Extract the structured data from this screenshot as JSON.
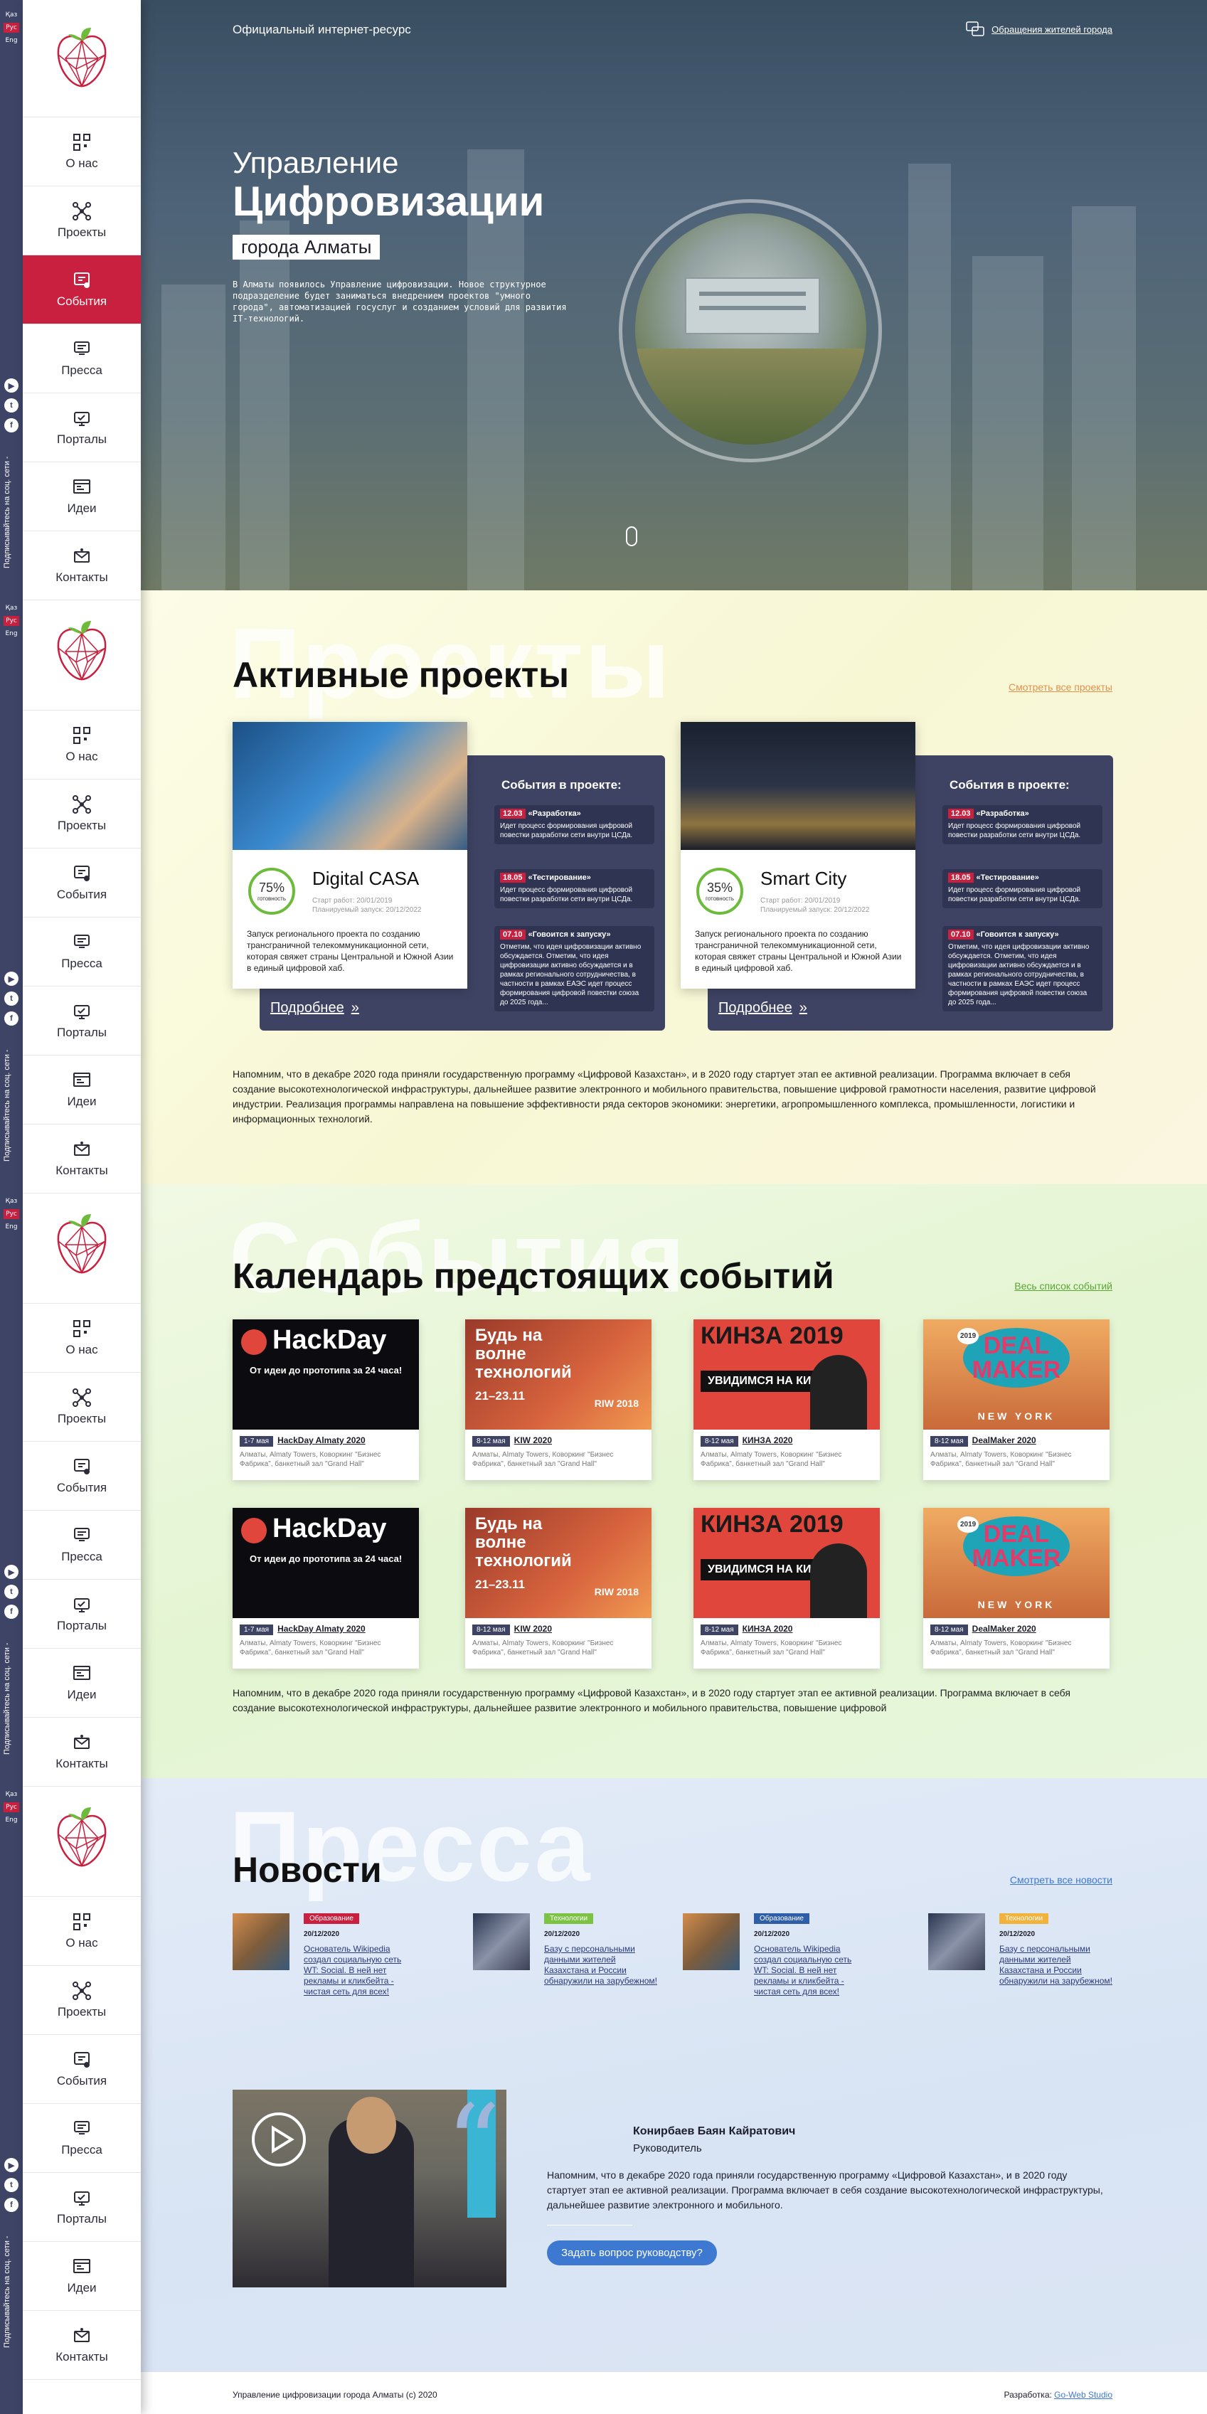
{
  "langs": [
    "Қаз",
    "Рус",
    "Eng"
  ],
  "social_text": "Подписывайтесь на соц. сети -",
  "social_icons": [
    "youtube-icon",
    "twitter-icon",
    "facebook-icon"
  ],
  "nav": [
    {
      "label": "О нас",
      "icon": "qr-icon"
    },
    {
      "label": "Проекты",
      "icon": "network-icon"
    },
    {
      "label": "События",
      "icon": "events-icon"
    },
    {
      "label": "Пресса",
      "icon": "press-icon"
    },
    {
      "label": "Порталы",
      "icon": "portal-icon"
    },
    {
      "label": "Идеи",
      "icon": "ideas-icon"
    },
    {
      "label": "Контакты",
      "icon": "contacts-icon"
    }
  ],
  "hero": {
    "top_label": "Официальный интернет-ресурс",
    "appeal_link": "Обращения жителей города",
    "line1": "Управление",
    "line2": "Цифровизации",
    "line3": "города Алматы",
    "desc": "В Алматы появилось Управление цифровизации. Новое структурное подразделение будет заниматься внедрением проектов \"умного города\", автоматизацией госуслуг и созданием условий для развития IT-технологий."
  },
  "projects": {
    "bg_word": "Проекты",
    "title": "Активные проекты",
    "all_link": "Смотреть все проекты",
    "events_title": "События в проекте:",
    "more_label": "Подробнее",
    "items": [
      {
        "name": "Digital CASA",
        "progress": "75%",
        "progress_label": "готовность",
        "start": "Старт работ: 20/01/2019",
        "planned": "Планируемый запуск: 20/12/2022",
        "text": "Запуск регионального проекта по созданию трансграничной телекоммуникационной сети, которая свяжет страны Центральной и Южной Азии в единый цифровой хаб.",
        "events": [
          {
            "date": "12.03",
            "title": "«Разработка»",
            "text": "Идет процесс формирования цифровой повестки разработки сети внутри ЦСДа."
          },
          {
            "date": "18.05",
            "title": "«Тестирование»",
            "text": "Идет процесс формирования цифровой повестки разработки сети внутри ЦСДа."
          },
          {
            "date": "07.10",
            "title": "«Говоится к запуску»",
            "text": "Отметим, что идея цифровизации активно обсуждается. Отметим, что идея цифровизации активно обсуждается и в рамках регионального сотрудничества, в частности в рамках ЕАЭС идет процесс формирования цифровой повестки союза до 2025 года..."
          }
        ]
      },
      {
        "name": "Smart City",
        "progress": "35%",
        "progress_label": "готовность",
        "start": "Старт работ: 20/01/2019",
        "planned": "Планируемый запуск: 20/12/2022",
        "text": "Запуск регионального проекта по созданию трансграничной телекоммуникационной сети, которая свяжет страны Центральной и Южной Азии в единый цифровой хаб.",
        "events": [
          {
            "date": "12.03",
            "title": "«Разработка»",
            "text": "Идет процесс формирования цифровой повестки разработки сети внутри ЦСДа."
          },
          {
            "date": "18.05",
            "title": "«Тестирование»",
            "text": "Идет процесс формирования цифровой повестки разработки сети внутри ЦСДа."
          },
          {
            "date": "07.10",
            "title": "«Говоится к запуску»",
            "text": "Отметим, что идея цифровизации активно обсуждается. Отметим, что идея цифровизации активно обсуждается и в рамках регионального сотрудничества, в частности в рамках ЕАЭС идет процесс формирования цифровой повестки союза до 2025 года..."
          }
        ]
      }
    ],
    "para": "Напомним, что в декабре 2020 года приняли государственную программу «Цифровой Казахстан», и в 2020 году стартует этап ее активной реализации. Программа включает в себя создание высокотехнологической инфраструктуры, дальнейшее развитие электронного и мобильного правительства, повышение цифровой грамотности населения, развитие цифровой индустрии. Реализация программы направлена на повышение эффективности ряда секторов экономики: энергетики, агропромышленного комплекса, промышленности, логистики и информационных технологий."
  },
  "events": {
    "bg_word": "События",
    "title": "Календарь предстоящих событий",
    "all_link": "Весь список событий",
    "items": [
      {
        "tag": "1-7 мая",
        "name": "HackDay Almaty 2020",
        "addr": "Алматы, Almaty Towers, Коворкинг \"Бизнес Фабрика\", банкетный зал \"Grand Hall\"",
        "img": "hackday",
        "img_title": "HackDay",
        "img_sub": "От идеи до прототипа за 24 часа!"
      },
      {
        "tag": "8-12 мая",
        "name": "KIW 2020",
        "addr": "Алматы, Almaty Towers, Коворкинг \"Бизнес Фабрика\", банкетный зал \"Grand Hall\"",
        "img": "kiw",
        "img_title": "Будь на волне технологий",
        "img_sub": "21–23.11",
        "img_extra": "RIW 2018"
      },
      {
        "tag": "8-12 мая",
        "name": "КИНЗА 2020",
        "addr": "Алматы, Almaty Towers, Коворкинг \"Бизнес Фабрика\", банкетный зал \"Grand Hall\"",
        "img": "kinza",
        "img_title": "КИНЗА 2019",
        "img_sub": "УВИДИМСЯ НА КИНЗЕ"
      },
      {
        "tag": "8-12 мая",
        "name": "DealMaker 2020",
        "addr": "Алматы, Almaty Towers, Коворкинг \"Бизнес Фабрика\", банкетный зал \"Grand Hall\"",
        "img": "deal",
        "img_title": "DEAL MAKER",
        "img_sub": "NEW YORK",
        "img_extra": "2019"
      },
      {
        "tag": "1-7 мая",
        "name": "HackDay Almaty 2020",
        "addr": "Алматы, Almaty Towers, Коворкинг \"Бизнес Фабрика\", банкетный зал \"Grand Hall\"",
        "img": "hackday",
        "img_title": "HackDay",
        "img_sub": "От идеи до прототипа за 24 часа!"
      },
      {
        "tag": "8-12 мая",
        "name": "KIW 2020",
        "addr": "Алматы, Almaty Towers, Коворкинг \"Бизнес Фабрика\", банкетный зал \"Grand Hall\"",
        "img": "kiw",
        "img_title": "Будь на волне технологий",
        "img_sub": "21–23.11",
        "img_extra": "RIW 2018"
      },
      {
        "tag": "8-12 мая",
        "name": "КИНЗА 2020",
        "addr": "Алматы, Almaty Towers, Коворкинг \"Бизнес Фабрика\", банкетный зал \"Grand Hall\"",
        "img": "kinza",
        "img_title": "КИНЗА 2019",
        "img_sub": "УВИДИМСЯ НА КИНЗЕ"
      },
      {
        "tag": "8-12 мая",
        "name": "DealMaker 2020",
        "addr": "Алматы, Almaty Towers, Коворкинг \"Бизнес Фабрика\", банкетный зал \"Grand Hall\"",
        "img": "deal",
        "img_title": "DEAL MAKER",
        "img_sub": "NEW YORK",
        "img_extra": "2019"
      }
    ],
    "para": "Напомним, что в декабре 2020 года приняли государственную программу «Цифровой Казахстан», и в 2020 году стартует этап ее активной реализации. Программа включает в себя создание высокотехнологической инфраструктуры, дальнейшее развитие электронного и мобильного правительства, повышение цифровой"
  },
  "news": {
    "bg_word": "Пресса",
    "title": "Новости",
    "all_link": "Смотреть все новости",
    "items": [
      {
        "cat": "Образование",
        "cat_color": "#c8203e",
        "date": "20/12/2020",
        "text": "Основатель Wikipedia создал социальную сеть WT: Social. В ней нет рекламы и кликбейта - чистая сеть для всех!",
        "thumb": "person"
      },
      {
        "cat": "Технологии",
        "cat_color": "#7cc243",
        "date": "20/12/2020",
        "text": "Базу с персональными данными жителей Казахстана и России обнаружили на зарубежном!",
        "thumb": "tech"
      },
      {
        "cat": "Образование",
        "cat_color": "#2f5ea8",
        "date": "20/12/2020",
        "text": "Основатель Wikipedia создал социальную сеть WT: Social. В ней нет рекламы и кликбейта - чистая сеть для всех!",
        "thumb": "person"
      },
      {
        "cat": "Технологии",
        "cat_color": "#f2b33d",
        "date": "20/12/2020",
        "text": "Базу с персональными данными жителей Казахстана и России обнаружили на зарубежном!",
        "thumb": "tech"
      }
    ]
  },
  "director": {
    "name": "Конирбаев Баян Кайратович",
    "position": "Руководитель",
    "text": "Напомним, что в декабре 2020 года приняли государственную программу «Цифровой Казахстан», и в 2020 году стартует этап ее активной реализации. Программа включает в себя создание высокотехнологической инфраструктуры, дальнейшее развитие электронного и мобильного.",
    "button": "Задать вопрос руководству?"
  },
  "footer": {
    "copyright": "Управление цифровизации города Алматы (c) 2020",
    "dev_label": "Разработка:",
    "dev_name": "Go-Web Studio"
  },
  "colors": {
    "accent": "#c8203e",
    "navy": "#3e4363",
    "progress": "#6dbb3a",
    "link_blue": "#3d79d1"
  }
}
